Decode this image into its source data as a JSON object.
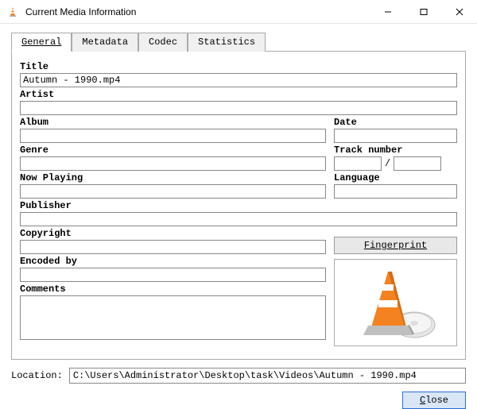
{
  "window": {
    "title": "Current Media Information"
  },
  "tabs": {
    "general": "General",
    "metadata": "Metadata",
    "codec": "Codec",
    "statistics": "Statistics"
  },
  "labels": {
    "title": "Title",
    "artist": "Artist",
    "album": "Album",
    "date": "Date",
    "genre": "Genre",
    "track_number": "Track number",
    "now_playing": "Now Playing",
    "language": "Language",
    "publisher": "Publisher",
    "copyright": "Copyright",
    "encoded_by": "Encoded by",
    "comments": "Comments",
    "fingerprint": "Fingerprint",
    "location": "Location:",
    "close_prefix": "C",
    "close_rest": "lose",
    "track_sep": "/"
  },
  "values": {
    "title": "Autumn - 1990.mp4",
    "artist": "",
    "album": "",
    "date": "",
    "genre": "",
    "track_a": "",
    "track_b": "",
    "now_playing": "",
    "language": "",
    "publisher": "",
    "copyright": "",
    "encoded_by": "",
    "comments": "",
    "location": "C:\\Users\\Administrator\\Desktop\\task\\Videos\\Autumn - 1990.mp4"
  }
}
